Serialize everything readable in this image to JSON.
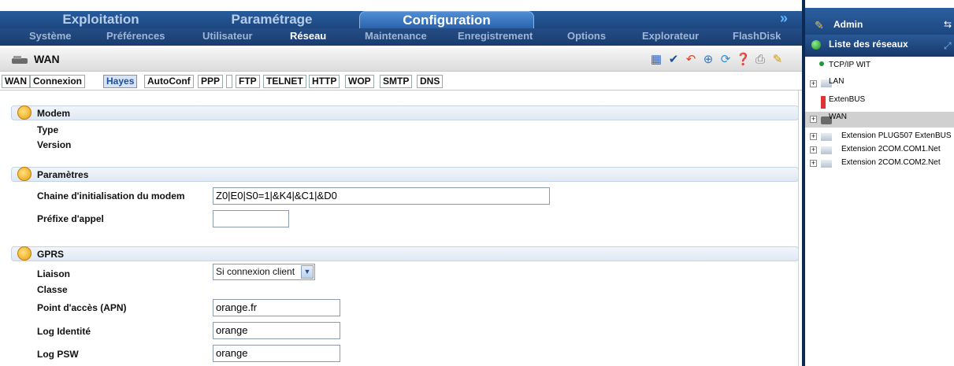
{
  "top_tabs": [
    "Exploitation",
    "Paramétrage",
    "Configuration"
  ],
  "sub_tabs": [
    "Système",
    "Préférences",
    "Utilisateur",
    "Réseau",
    "Maintenance",
    "Enregistrement",
    "Options",
    "Explorateur",
    "FlashDisk"
  ],
  "page_title": "WAN",
  "page_tabs": [
    "WAN",
    "Connexion",
    "Hayes",
    "AutoConf",
    "PPP",
    "",
    "FTP",
    "TELNET",
    "HTTP",
    "WOP",
    "SMTP",
    "DNS"
  ],
  "active_page_tab": "Hayes",
  "sections": {
    "modem": {
      "title": "Modem",
      "type_label": "Type",
      "version_label": "Version"
    },
    "parametres": {
      "title": "Paramètres",
      "init_label": "Chaine d'initialisation du modem",
      "init_value": "Z0|E0|S0=1|&K4|&C1|&D0",
      "prefix_label": "Préfixe d'appel",
      "prefix_value": ""
    },
    "gprs": {
      "title": "GPRS",
      "liaison_label": "Liaison",
      "liaison_value": "Si connexion client",
      "classe_label": "Classe",
      "apn_label": "Point d'accès (APN)",
      "apn_value": "orange.fr",
      "log_id_label": "Log Identité",
      "log_id_value": "orange",
      "log_psw_label": "Log PSW",
      "log_psw_value": "orange"
    }
  },
  "side": {
    "admin": "Admin",
    "title": "Liste des réseaux",
    "tree": [
      "TCP/IP WIT",
      "LAN",
      "ExtenBUS",
      "WAN",
      "Extension PLUG507 ExtenBUS",
      "Extension 2COM.COM1.Net",
      "Extension 2COM.COM2.Net"
    ]
  },
  "colors": {
    "accent": "#1d4e99",
    "header_bg": "#1f4f8c",
    "selected": "#d0d0d0"
  }
}
